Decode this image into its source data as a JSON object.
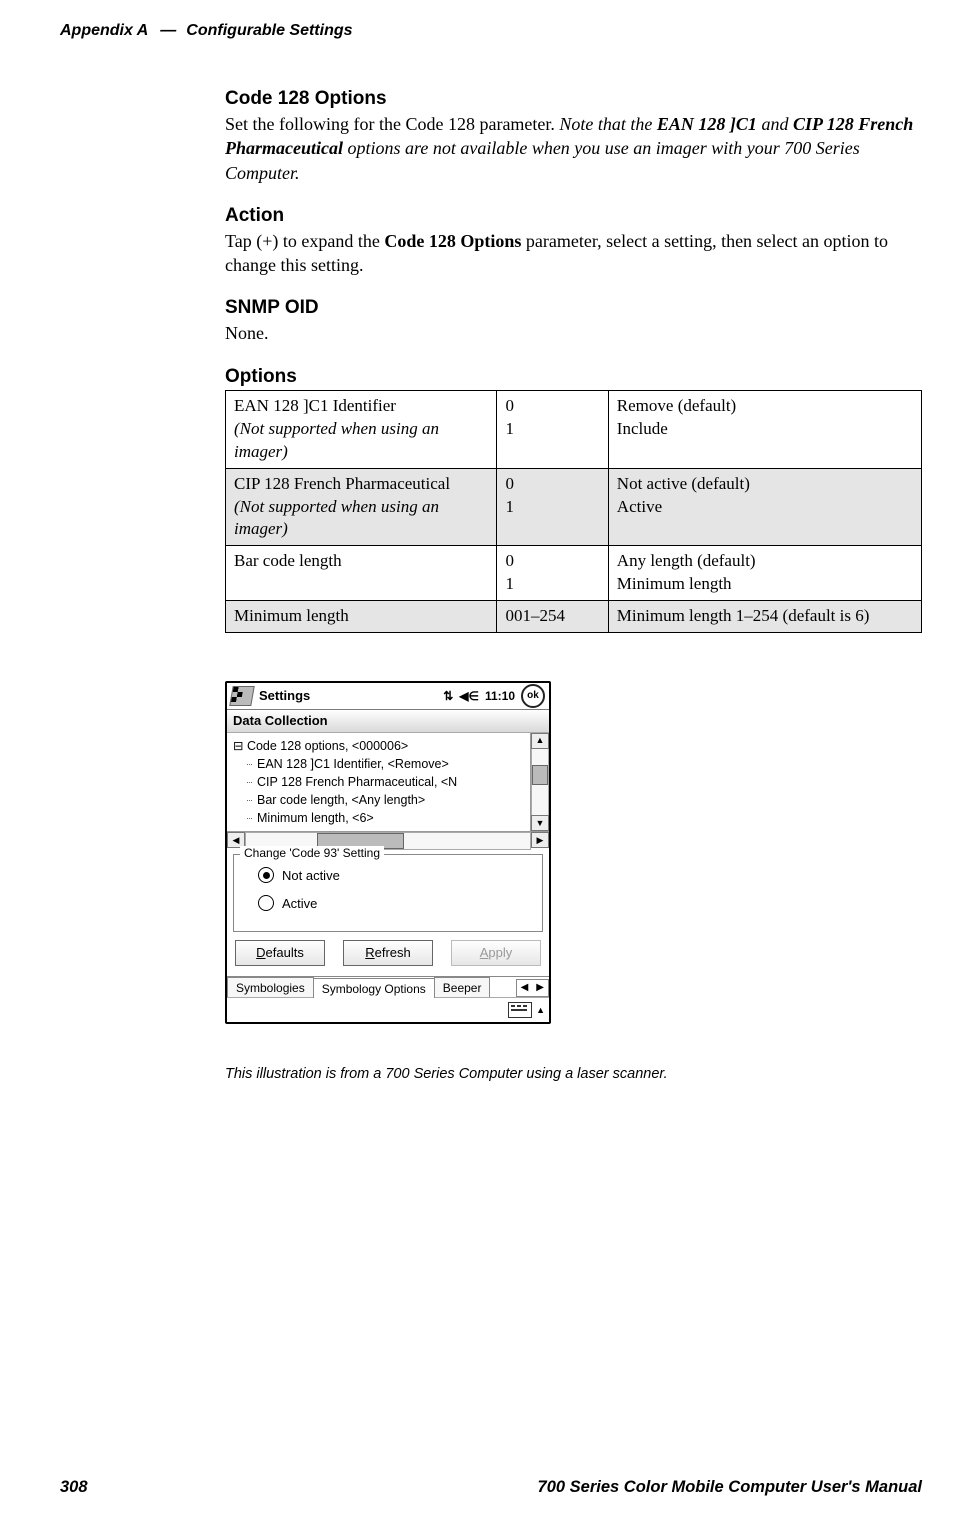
{
  "header": {
    "appendix": "Appendix A",
    "dash": "—",
    "title": "Configurable Settings"
  },
  "section": {
    "heading": "Code 128 Options",
    "intro_plain": "Set the following for the Code 128 parameter. ",
    "intro_italic_pre": "Note that the ",
    "intro_italic_b1": "EAN 128 ]C1",
    "intro_italic_mid": " and ",
    "intro_italic_b2": "CIP 128 French Pharmaceutical",
    "intro_italic_post": " options are not available when you use an imager with your 700 Series Computer."
  },
  "action": {
    "heading": "Action",
    "text_pre": "Tap (+) to expand the ",
    "text_bold": "Code 128 Options",
    "text_post": " parameter, select a setting, then select an option to change this setting."
  },
  "snmp": {
    "heading": "SNMP OID",
    "text": "None."
  },
  "options": {
    "heading": "Options",
    "rows": [
      {
        "name_line1": "EAN 128 ]C1 Identifier",
        "name_line2": "(Not supported when using an imager)",
        "codes": "0\n1",
        "desc": "Remove (default)\nInclude",
        "shade": false,
        "name_line2_italic": true
      },
      {
        "name_line1": "CIP 128 French Pharmaceutical",
        "name_line2": "(Not supported when using an imager)",
        "codes": "0\n1",
        "desc": "Not active (default)\nActive",
        "shade": true,
        "name_line2_italic": true
      },
      {
        "name_line1": "Bar code length",
        "name_line2": "",
        "codes": "0\n1",
        "desc": "Any length (default)\nMinimum length",
        "shade": false,
        "name_line2_italic": false
      },
      {
        "name_line1": "Minimum length",
        "name_line2": "",
        "codes": "001–254",
        "desc": "Minimum length 1–254 (default is 6)",
        "shade": true,
        "name_line2_italic": false
      }
    ]
  },
  "pda": {
    "titlebar": {
      "title": "Settings",
      "time": "11:10",
      "ok": "ok"
    },
    "subtitle": "Data Collection",
    "tree": {
      "root": "Code 128 options, <000006>",
      "leaves": [
        "EAN 128 ]C1 Identifier, <Remove>",
        "CIP 128 French Pharmaceutical, <N",
        "Bar code length, <Any length>",
        "Minimum length, <6>"
      ]
    },
    "group": {
      "legend": "Change 'Code 93' Setting",
      "radios": [
        {
          "label": "Not active",
          "checked": true
        },
        {
          "label": "Active",
          "checked": false
        }
      ]
    },
    "buttons": {
      "defaults": "Defaults",
      "refresh": "Refresh",
      "apply": "Apply"
    },
    "tabs": {
      "t1": "Symbologies",
      "t2": "Symbology Options",
      "t3": "Beeper"
    }
  },
  "caption": "This illustration is  from a 700 Series Computer using a laser scanner.",
  "footer": {
    "page": "308",
    "manual": "700 Series Color Mobile Computer User's Manual"
  }
}
